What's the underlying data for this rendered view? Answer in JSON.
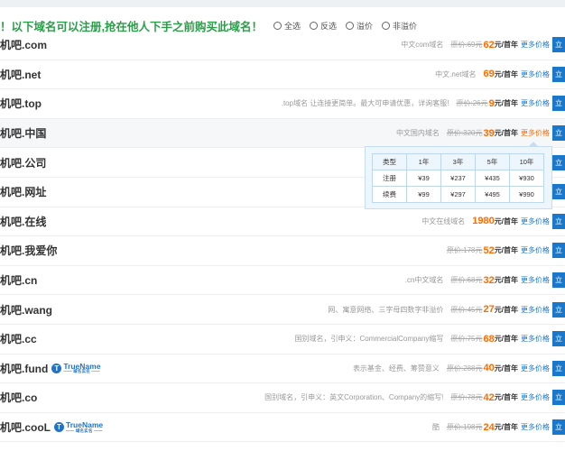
{
  "notice": {
    "text": "！以下域名可以注册,抢在他人下手之前购买此域名！",
    "options": [
      "全选",
      "反选",
      "溢价",
      "非溢价"
    ]
  },
  "rows": [
    {
      "domain": "机吧.com",
      "desc": "中文com域名",
      "old": "原价:69元",
      "price": "62",
      "unit": "元/首年",
      "more": "更多价格",
      "buy": "立"
    },
    {
      "domain": "机吧.net",
      "desc": "中文.net域名",
      "old": "",
      "price": "69",
      "unit": "元/首年",
      "more": "更多价格",
      "buy": "立"
    },
    {
      "domain": "机吧.top",
      "desc": ".top域名 让连接更简单。最大可申请优惠，详询客服!",
      "old": "原价:26元",
      "price": "9",
      "unit": "元/首年",
      "more": "更多价格",
      "buy": "立"
    },
    {
      "domain": "机吧.中国",
      "desc": "中文国内域名",
      "old": "原价:320元",
      "price": "39",
      "unit": "元/首年",
      "more": "更多价格",
      "buy": "立"
    },
    {
      "domain": "机吧.公司",
      "desc": "",
      "old": "",
      "price": "",
      "unit": "",
      "more": "",
      "buy": "立"
    },
    {
      "domain": "机吧.网址",
      "desc": "",
      "old": "",
      "price": "",
      "unit": "",
      "more": "",
      "buy": "立"
    },
    {
      "domain": "机吧.在线",
      "desc": "中文在线域名",
      "old": "",
      "price": "1980",
      "unit": "元/首年",
      "more": "更多价格",
      "buy": "立"
    },
    {
      "domain": "机吧.我爱你",
      "desc": "",
      "old": "原价:178元",
      "price": "52",
      "unit": "元/首年",
      "more": "更多价格",
      "buy": "立"
    },
    {
      "domain": "机吧.cn",
      "desc": ".cn中文域名",
      "old": "原价:68元",
      "price": "32",
      "unit": "元/首年",
      "more": "更多价格",
      "buy": "立"
    },
    {
      "domain": "机吧.wang",
      "desc": "网、寓意网络、三字母四数字非溢价",
      "old": "原价:45元",
      "price": "27",
      "unit": "元/首年",
      "more": "更多价格",
      "buy": "立"
    },
    {
      "domain": "机吧.cc",
      "desc": "国别域名，引申义：CommercialCompany缩写",
      "old": "原价:75元",
      "price": "68",
      "unit": "元/首年",
      "more": "更多价格",
      "buy": "立"
    },
    {
      "domain": "机吧.fund",
      "desc": "表示基金、经费、筹赞意义",
      "old": "原价:288元",
      "price": "40",
      "unit": "元/首年",
      "more": "更多价格",
      "buy": "立"
    },
    {
      "domain": "机吧.co",
      "desc": "国别域名，引申义：英文Corporation、Company的缩写!",
      "old": "原价:78元",
      "price": "42",
      "unit": "元/首年",
      "more": "更多价格",
      "buy": "立"
    },
    {
      "domain": "机吧.cooL",
      "desc": "酷",
      "old": "原价:198元",
      "price": "24",
      "unit": "元/首年",
      "more": "更多价格",
      "buy": "立"
    }
  ],
  "badge": {
    "letter": "T",
    "main": "TrueName",
    "sub": "—— 域名实名 ——"
  },
  "price_popup": {
    "header": [
      "类型",
      "1年",
      "3年",
      "5年",
      "10年"
    ],
    "register": [
      "注册",
      "¥39",
      "¥237",
      "¥435",
      "¥930"
    ],
    "renew": [
      "续费",
      "¥99",
      "¥297",
      "¥495",
      "¥990"
    ]
  },
  "colors": {
    "green": "#2a9d48",
    "orange": "#ff6a00",
    "blue": "#1a77c9"
  }
}
